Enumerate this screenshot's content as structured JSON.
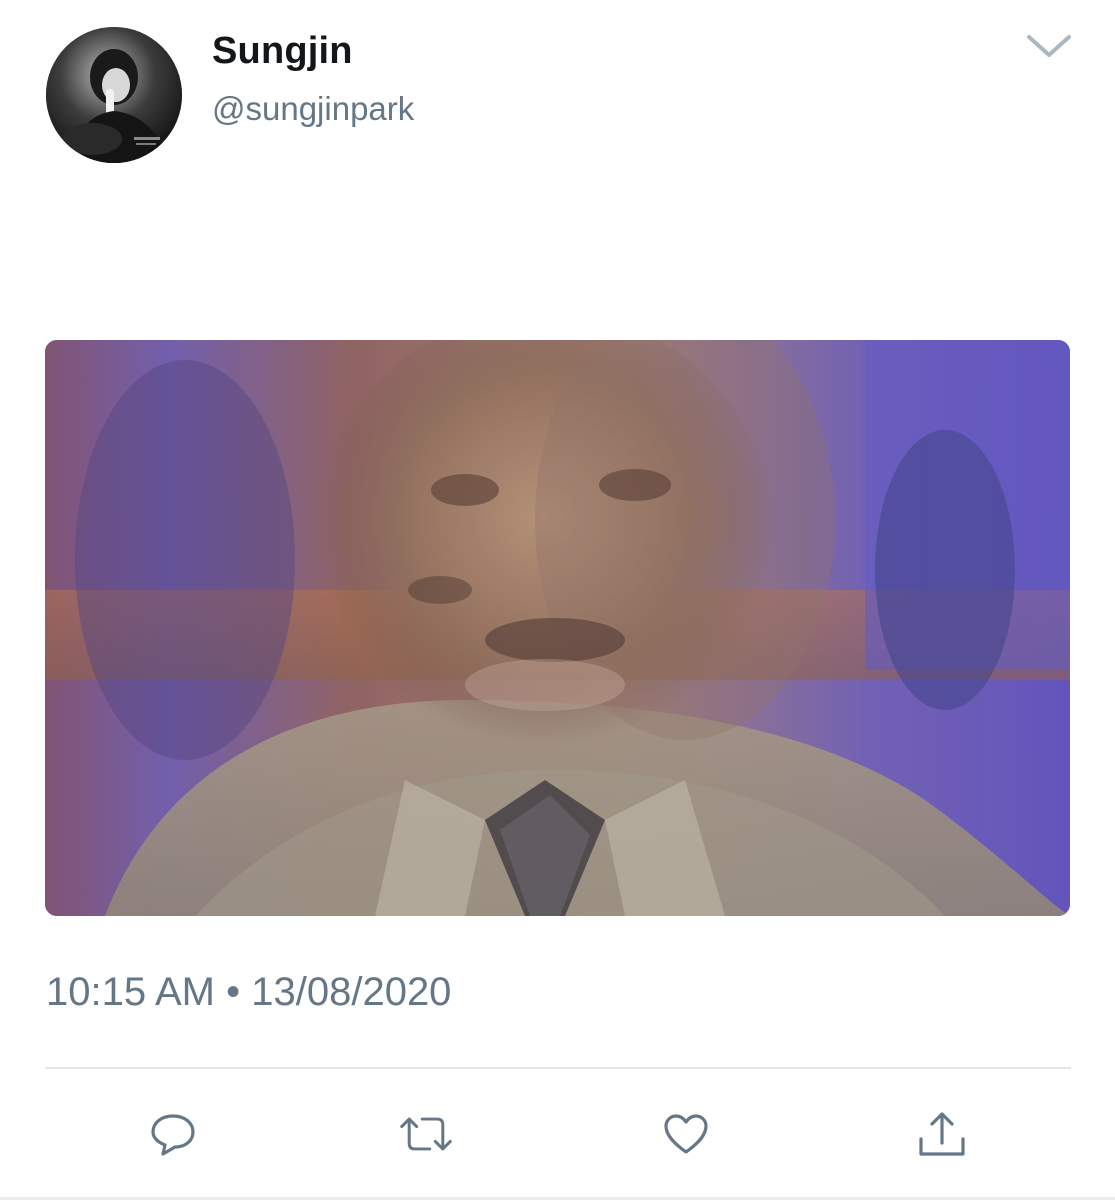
{
  "tweet": {
    "display_name": "Sungjin",
    "handle": "@sungjinpark",
    "timestamp": "10:15 AM • 13/08/2020"
  },
  "icons": {
    "menu": "chevron-down-icon",
    "reply": "reply-icon",
    "retweet": "retweet-icon",
    "like": "heart-icon",
    "share": "share-icon"
  },
  "colors": {
    "name": "#14171a",
    "secondary_text": "#657786",
    "icon": "#657786",
    "divider": "#e1e8ed"
  }
}
